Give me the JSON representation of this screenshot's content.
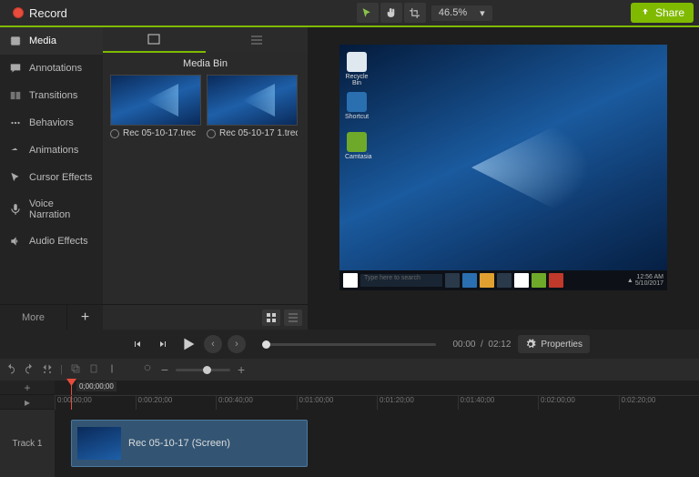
{
  "topbar": {
    "record_label": "Record",
    "zoom_value": "46.5%",
    "share_label": "Share"
  },
  "sidebar": {
    "items": [
      {
        "label": "Media",
        "icon": "film"
      },
      {
        "label": "Annotations",
        "icon": "callout"
      },
      {
        "label": "Transitions",
        "icon": "transition"
      },
      {
        "label": "Behaviors",
        "icon": "behavior"
      },
      {
        "label": "Animations",
        "icon": "animation"
      },
      {
        "label": "Cursor Effects",
        "icon": "cursor"
      },
      {
        "label": "Voice Narration",
        "icon": "mic"
      },
      {
        "label": "Audio Effects",
        "icon": "speaker"
      }
    ],
    "more_label": "More"
  },
  "mediabin": {
    "title": "Media Bin",
    "clips": [
      {
        "name": "Rec 05-10-17.trec"
      },
      {
        "name": "Rec 05-10-17 1.trec"
      }
    ]
  },
  "preview": {
    "desktop_icons": [
      {
        "label": "Recycle Bin",
        "color": "#dfe7ef"
      },
      {
        "label": "Shortcut",
        "color": "#2a6fb0"
      },
      {
        "label": "Camtasia",
        "color": "#6fa92a"
      }
    ],
    "search_placeholder": "Type here to search",
    "tray_time": "12:56 AM",
    "tray_date": "5/10/2017"
  },
  "playback": {
    "current_time": "00:00",
    "total_time": "02:12",
    "properties_label": "Properties"
  },
  "timeline": {
    "playhead_position": "0;00;00;00",
    "ticks": [
      "0:00:00;00",
      "0:00:20;00",
      "0:00:40;00",
      "0:01:00;00",
      "0:01:20;00",
      "0:01:40;00",
      "0:02:00;00",
      "0:02:20;00"
    ],
    "tracks": [
      {
        "name": "Track 1",
        "clip_label": "Rec 05-10-17 (Screen)"
      }
    ]
  }
}
